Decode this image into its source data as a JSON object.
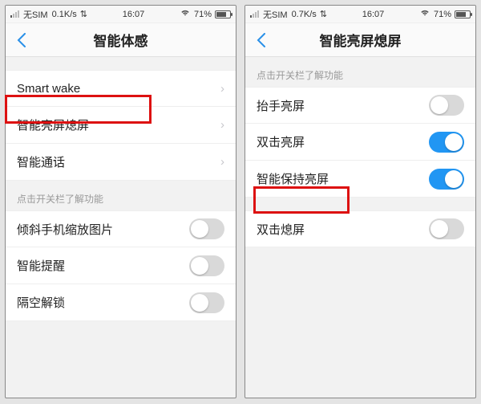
{
  "status": {
    "carrier": "无SIM",
    "speed1": "0.1K/s",
    "speed2": "0.7K/s",
    "time": "16:07",
    "battery_pct": "71%"
  },
  "left": {
    "title": "智能体感",
    "group1": [
      {
        "label": "Smart wake",
        "type": "disclosure"
      },
      {
        "label": "智能亮屏熄屏",
        "type": "disclosure"
      },
      {
        "label": "智能通话",
        "type": "disclosure"
      }
    ],
    "hint": "点击开关栏了解功能",
    "group2": [
      {
        "label": "倾斜手机缩放图片",
        "type": "toggle",
        "on": false
      },
      {
        "label": "智能提醒",
        "type": "toggle",
        "on": false
      },
      {
        "label": "隔空解锁",
        "type": "toggle",
        "on": false
      }
    ]
  },
  "right": {
    "title": "智能亮屏熄屏",
    "hint": "点击开关栏了解功能",
    "group1": [
      {
        "label": "抬手亮屏",
        "type": "toggle",
        "on": false
      },
      {
        "label": "双击亮屏",
        "type": "toggle",
        "on": true
      },
      {
        "label": "智能保持亮屏",
        "type": "toggle",
        "on": true
      }
    ],
    "group2": [
      {
        "label": "双击熄屏",
        "type": "toggle",
        "on": false
      }
    ]
  },
  "colors": {
    "accent": "#2196f3",
    "highlight": "#d11"
  }
}
